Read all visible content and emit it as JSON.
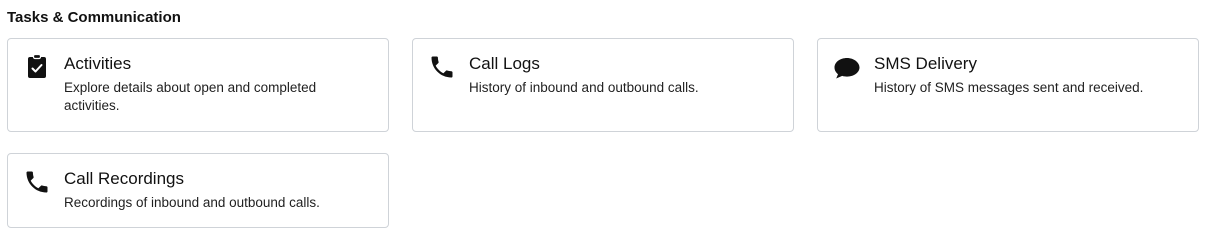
{
  "section": {
    "title": "Tasks & Communication"
  },
  "cards": [
    {
      "title": "Activities",
      "description": "Explore details about open and completed activities.",
      "icon": "clipboard-check-icon"
    },
    {
      "title": "Call Logs",
      "description": "History of inbound and outbound calls.",
      "icon": "phone-icon"
    },
    {
      "title": "SMS Delivery",
      "description": "History of SMS messages sent and received.",
      "icon": "chat-bubble-icon"
    },
    {
      "title": "Call Recordings",
      "description": "Recordings of inbound and outbound calls.",
      "icon": "phone-icon"
    }
  ],
  "colors": {
    "border": "#cfd3d8",
    "icon": "#111111",
    "text": "#111111"
  }
}
